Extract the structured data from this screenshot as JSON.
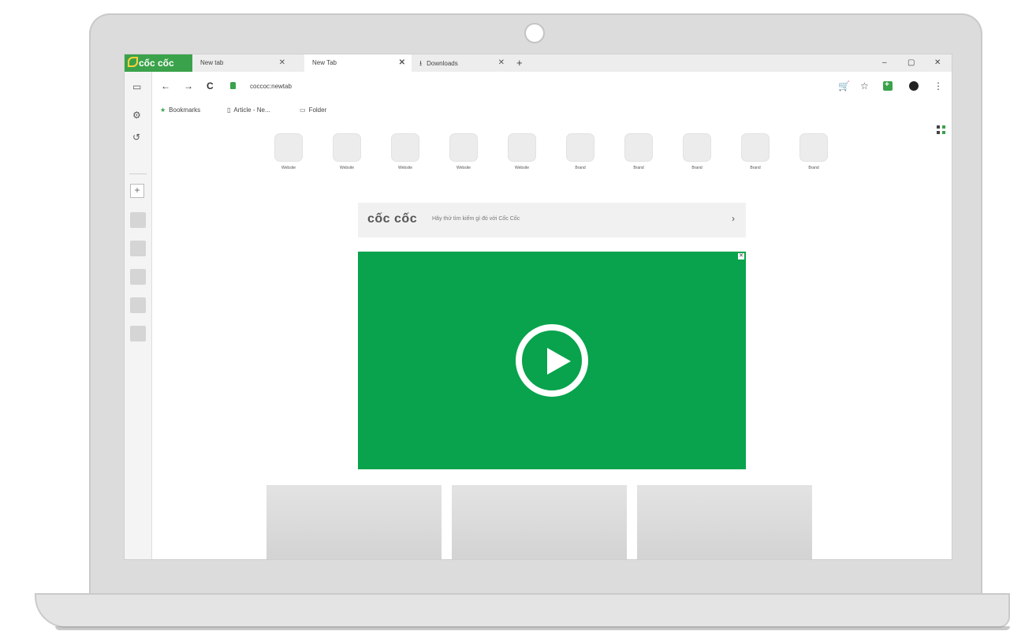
{
  "browser": {
    "brand": "cốc cốc",
    "tabs": [
      {
        "label": "New tab",
        "close": "✕"
      },
      {
        "label": "New Tab",
        "close": "✕"
      },
      {
        "label": "Downloads",
        "close": "✕"
      }
    ],
    "new_tab": "+",
    "window_controls": {
      "minimize": "–",
      "maximize": "▢",
      "close": "✕"
    }
  },
  "toolbar": {
    "back": "←",
    "forward": "→",
    "reload": "C",
    "address": "coccoc:newtab",
    "cart": "🛒",
    "bookmark_star": "☆",
    "menu": "⋮"
  },
  "bookmarks_bar": [
    {
      "label": "Bookmarks",
      "icon": "star-icon"
    },
    {
      "label": "Article - Ne...",
      "icon": "page-icon"
    },
    {
      "label": "Folder",
      "icon": "folder-icon"
    }
  ],
  "sidebar": {
    "plus": "+"
  },
  "speed_dial": [
    {
      "label": "Website"
    },
    {
      "label": "Website"
    },
    {
      "label": "Website"
    },
    {
      "label": "Website"
    },
    {
      "label": "Website"
    },
    {
      "label": "Brand"
    },
    {
      "label": "Brand"
    },
    {
      "label": "Brand"
    },
    {
      "label": "Brand"
    },
    {
      "label": "Brand"
    }
  ],
  "search": {
    "logo": "cốc cốc",
    "placeholder": "Hãy thử tìm kiếm gì đó với Cốc Cốc",
    "arrow": "›"
  },
  "video": {
    "close": "✕"
  },
  "colors": {
    "brand_green": "#3aa24a",
    "video_green": "#08a34c"
  }
}
